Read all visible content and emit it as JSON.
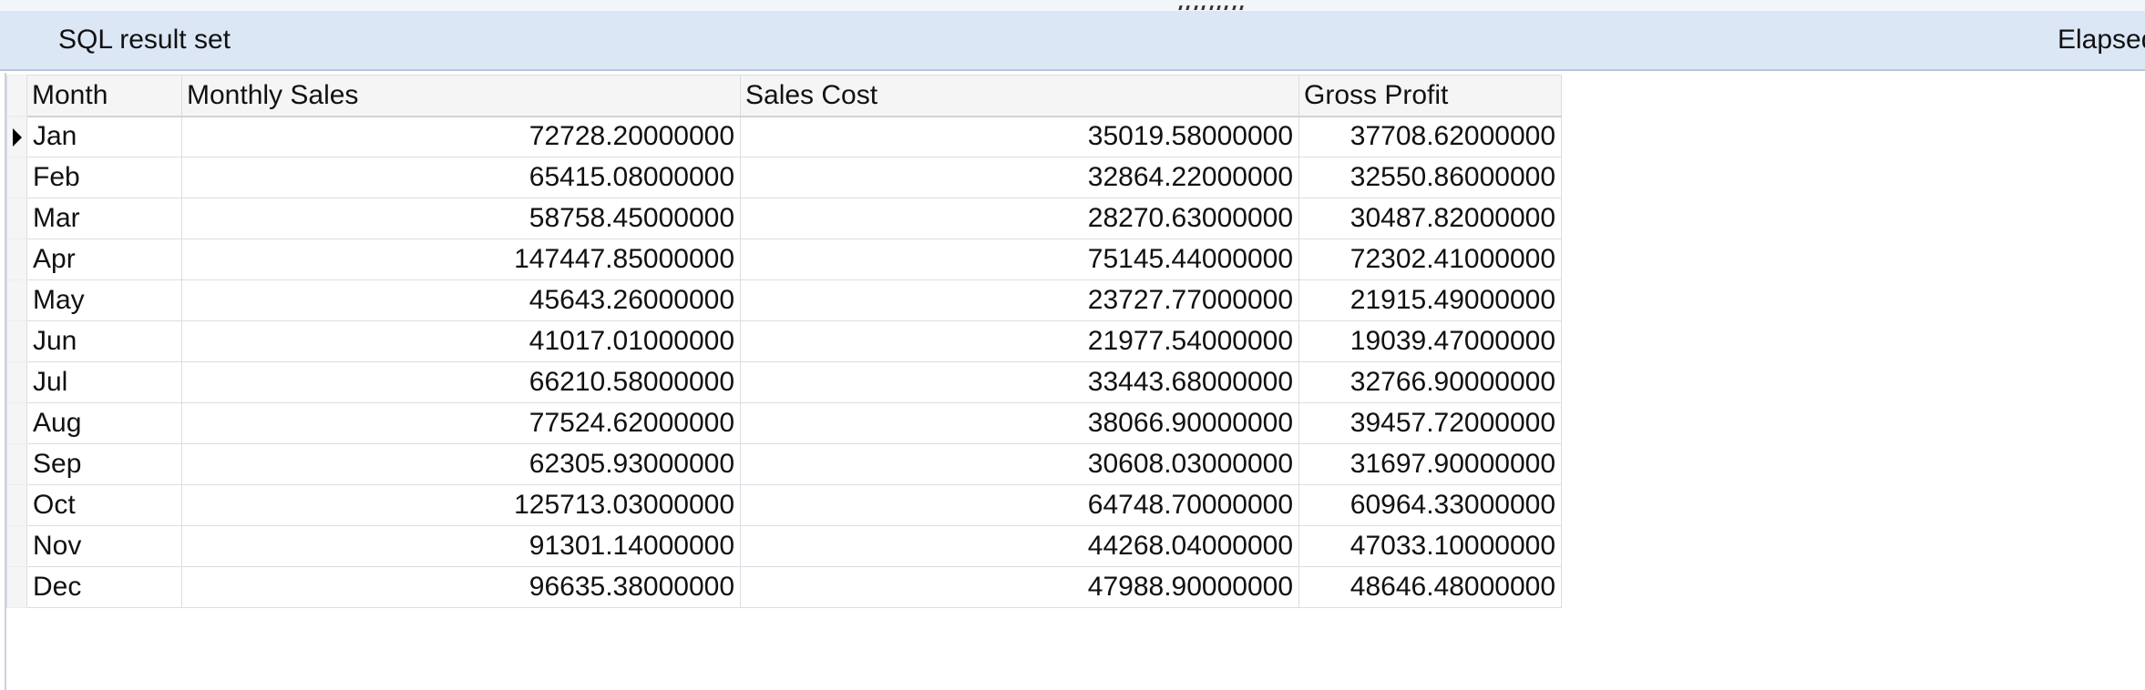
{
  "panel": {
    "title": "SQL result set",
    "elapsed_label": "Elapsed"
  },
  "grid": {
    "columns": [
      "Month",
      "Monthly Sales",
      "Sales Cost",
      "Gross Profit"
    ],
    "current_row": 0,
    "rows": [
      [
        "Jan",
        "72728.20000000",
        "35019.58000000",
        "37708.62000000"
      ],
      [
        "Feb",
        "65415.08000000",
        "32864.22000000",
        "32550.86000000"
      ],
      [
        "Mar",
        "58758.45000000",
        "28270.63000000",
        "30487.82000000"
      ],
      [
        "Apr",
        "147447.85000000",
        "75145.44000000",
        "72302.41000000"
      ],
      [
        "May",
        "45643.26000000",
        "23727.77000000",
        "21915.49000000"
      ],
      [
        "Jun",
        "41017.01000000",
        "21977.54000000",
        "19039.47000000"
      ],
      [
        "Jul",
        "66210.58000000",
        "33443.68000000",
        "32766.90000000"
      ],
      [
        "Aug",
        "77524.62000000",
        "38066.90000000",
        "39457.72000000"
      ],
      [
        "Sep",
        "62305.93000000",
        "30608.03000000",
        "31697.90000000"
      ],
      [
        "Oct",
        "125713.03000000",
        "64748.70000000",
        "60964.33000000"
      ],
      [
        "Nov",
        "91301.14000000",
        "44268.04000000",
        "47033.10000000"
      ],
      [
        "Dec",
        "96635.38000000",
        "47988.90000000",
        "48646.48000000"
      ]
    ]
  }
}
